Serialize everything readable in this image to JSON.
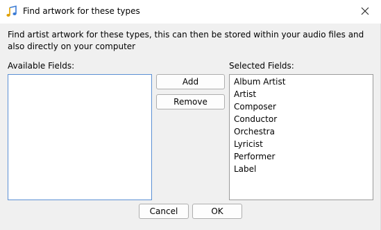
{
  "window": {
    "title": "Find artwork for these types",
    "app_icon": "music-note-icon",
    "close_icon": "close-icon"
  },
  "description": "Find artist artwork for these types, this can then be stored within your audio files and also directly on your computer",
  "available": {
    "label": "Available Fields:",
    "items": []
  },
  "buttons": {
    "add": "Add",
    "remove": "Remove",
    "cancel": "Cancel",
    "ok": "OK"
  },
  "selected": {
    "label": "Selected Fields:",
    "items": [
      "Album Artist",
      "Artist",
      "Composer",
      "Conductor",
      "Orchestra",
      "Lyricist",
      "Performer",
      "Label"
    ]
  }
}
